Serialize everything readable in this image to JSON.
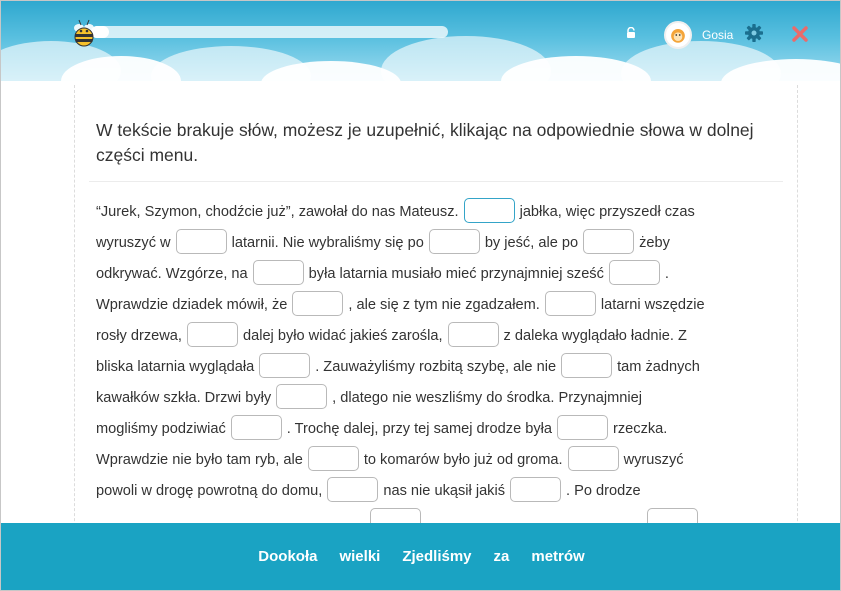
{
  "header": {
    "progress_fraction": 0.05,
    "username": "Gosia",
    "icons": [
      "bee-logo-icon",
      "lock-icon",
      "avatar",
      "gear-icon",
      "close-icon"
    ],
    "colors": {
      "sky": "#2fa8cf",
      "gear": "#1b6f8f",
      "close": "#e96b6b"
    }
  },
  "instruction": "W tekście brakuje słów, możesz je uzupełnić, klikając na odpowiednie słowa w dolnej części menu.",
  "exercise": {
    "lines": [
      [
        "“Jurek, Szymon, chodźcie już”, zawołał do nas Mateusz.",
        "jabłka, więc przyszedł czas"
      ],
      [
        "wyruszyć w",
        "latarnii. Nie wybraliśmy się po",
        "by jeść, ale po",
        "żeby"
      ],
      [
        "odkrywać. Wzgórze, na",
        "była latarnia musiało mieć przynajmniej sześć",
        "."
      ],
      [
        "Wprawdzie dziadek mówił, że",
        ", ale się z tym nie zgadzałem.",
        "latarni wszędzie"
      ],
      [
        "rosły drzewa,",
        "dalej było widać jakieś zarośla,",
        "z daleka wyglądało ładnie. Z"
      ],
      [
        "bliska latarnia wyglądała",
        ". Zauważyliśmy rozbitą szybę, ale nie",
        "tam żadnych"
      ],
      [
        "kawałków szkła. Drzwi były",
        ", dlatego nie weszliśmy do środka. Przynajmniej"
      ],
      [
        "mogliśmy podziwiać",
        ". Trochę dalej, przy tej samej drodze była",
        "rzeczka."
      ],
      [
        "Wprawdzie nie było tam ryb, ale",
        "to komarów było już od groma.",
        "wyruszyć"
      ],
      [
        "powoli w drogę powrotną do domu,",
        "nas nie ukąsił jakiś",
        ". Po drodze"
      ]
    ]
  },
  "word_bank": [
    "Dookoła",
    "wielki",
    "Zjedliśmy",
    "za",
    "metrów"
  ],
  "colors": {
    "word_bar": "#1aa3c3",
    "active_gap": "#34a4c8"
  }
}
